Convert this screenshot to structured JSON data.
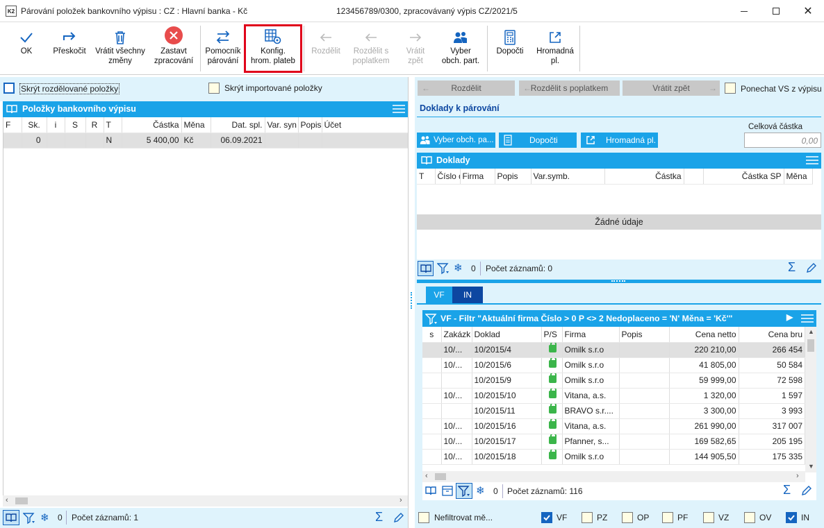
{
  "window": {
    "title": "Párování položek bankovního výpisu : CZ : Hlavní banka - Kč",
    "subtitle": "123456789/0300, zpracovávaný výpis CZ/2021/5",
    "app_icon": "K2"
  },
  "toolbar": {
    "ok": "OK",
    "skip": "Přeskočit",
    "revert_all": "Vrátit všechny\nzměny",
    "stop": "Zastavt\nzpracování",
    "helper": "Pomocník\npárování",
    "config": "Konfig.\nhrom. plateb",
    "split": "Rozdělit",
    "split_fee": "Rozdělit s\npoplatkem",
    "revert": "Vrátit\nzpět",
    "select_partner": "Vyber\nobch. part.",
    "complete": "Dopočti",
    "bulk": "Hromadná\npl."
  },
  "left": {
    "hide_split": "Skrýt rozdělované položky",
    "hide_imported": "Skrýt importované položky",
    "panel_title": "Položky bankovního výpisu",
    "columns": [
      "F",
      "Sk.",
      "i",
      "S",
      "R",
      "T",
      "Částka",
      "Měna",
      "Dat. spl.",
      "Var. syn",
      "Popis",
      "Účet"
    ],
    "row": {
      "sk": "0",
      "t": "N",
      "amount": "5 400,00",
      "currency": "Kč",
      "date": "06.09.2021"
    },
    "count_zero": "0",
    "count": "Počet záznamů: 1"
  },
  "right": {
    "split": "Rozdělit",
    "split_fee": "Rozdělit s poplatkem",
    "revert": "Vrátit zpět",
    "keep_vs": "Ponechat VS z výpisu",
    "docs_title": "Doklady k párování",
    "total_label": "Celková částka",
    "total_value": "0,00",
    "btn_partner": "Vyber obch. pa...",
    "btn_complete": "Dopočti",
    "btn_bulk": "Hromadná pl.",
    "doklady_title": "Doklady",
    "doklady_columns": [
      "T",
      "Číslo d",
      "Firma",
      "Popis",
      "Var.symb.",
      "Částka",
      "Částka SP",
      "Měna"
    ],
    "no_data": "Žádné údaje",
    "doklady_count_zero": "0",
    "doklady_count": "Počet záznamů: 0",
    "tab_vf": "VF",
    "tab_in": "IN",
    "filter_title": "VF - Filtr \"Aktuální firma  Číslo > 0  P <> 2  Nedoplaceno = 'N'  Měna = 'Kč'\"",
    "inv_columns": [
      "s",
      "Zakázk",
      "Doklad",
      "P/S",
      "Firma",
      "Popis",
      "Cena netto",
      "Cena bru"
    ],
    "invoices": [
      {
        "zak": "10/...",
        "doklad": "10/2015/4",
        "firma": "Omilk s.r.o",
        "netto": "220 210,00",
        "brutto": "266 454"
      },
      {
        "zak": "10/...",
        "doklad": "10/2015/6",
        "firma": "Omilk s.r.o",
        "netto": "41 805,00",
        "brutto": "50 584"
      },
      {
        "zak": "",
        "doklad": "10/2015/9",
        "firma": "Omilk s.r.o",
        "netto": "59 999,00",
        "brutto": "72 598"
      },
      {
        "zak": "10/...",
        "doklad": "10/2015/10",
        "firma": "Vitana, a.s.",
        "netto": "1 320,00",
        "brutto": "1 597"
      },
      {
        "zak": "",
        "doklad": "10/2015/11",
        "firma": "BRAVO s.r....",
        "netto": "3 300,00",
        "brutto": "3 993"
      },
      {
        "zak": "10/...",
        "doklad": "10/2015/16",
        "firma": "Vitana, a.s.",
        "netto": "261 990,00",
        "brutto": "317 007"
      },
      {
        "zak": "10/...",
        "doklad": "10/2015/17",
        "firma": "Pfanner, s...",
        "netto": "169 582,65",
        "brutto": "205 195"
      },
      {
        "zak": "10/...",
        "doklad": "10/2015/18",
        "firma": "Omilk s.r.o",
        "netto": "144 905,50",
        "brutto": "175 335"
      }
    ],
    "inv_count_zero": "0",
    "inv_count": "Počet záznamů: 116",
    "nofilter": "Nefiltrovat mě...",
    "type_filters": [
      {
        "label": "VF",
        "checked": true
      },
      {
        "label": "PZ",
        "checked": false
      },
      {
        "label": "OP",
        "checked": false
      },
      {
        "label": "PF",
        "checked": false
      },
      {
        "label": "VZ",
        "checked": false
      },
      {
        "label": "OV",
        "checked": false
      },
      {
        "label": "IN",
        "checked": true
      }
    ]
  },
  "colors": {
    "accent": "#1aa3e8",
    "light": "#dff3fc",
    "highlight": "#e0001a",
    "tab_active": "#0d47a1"
  }
}
